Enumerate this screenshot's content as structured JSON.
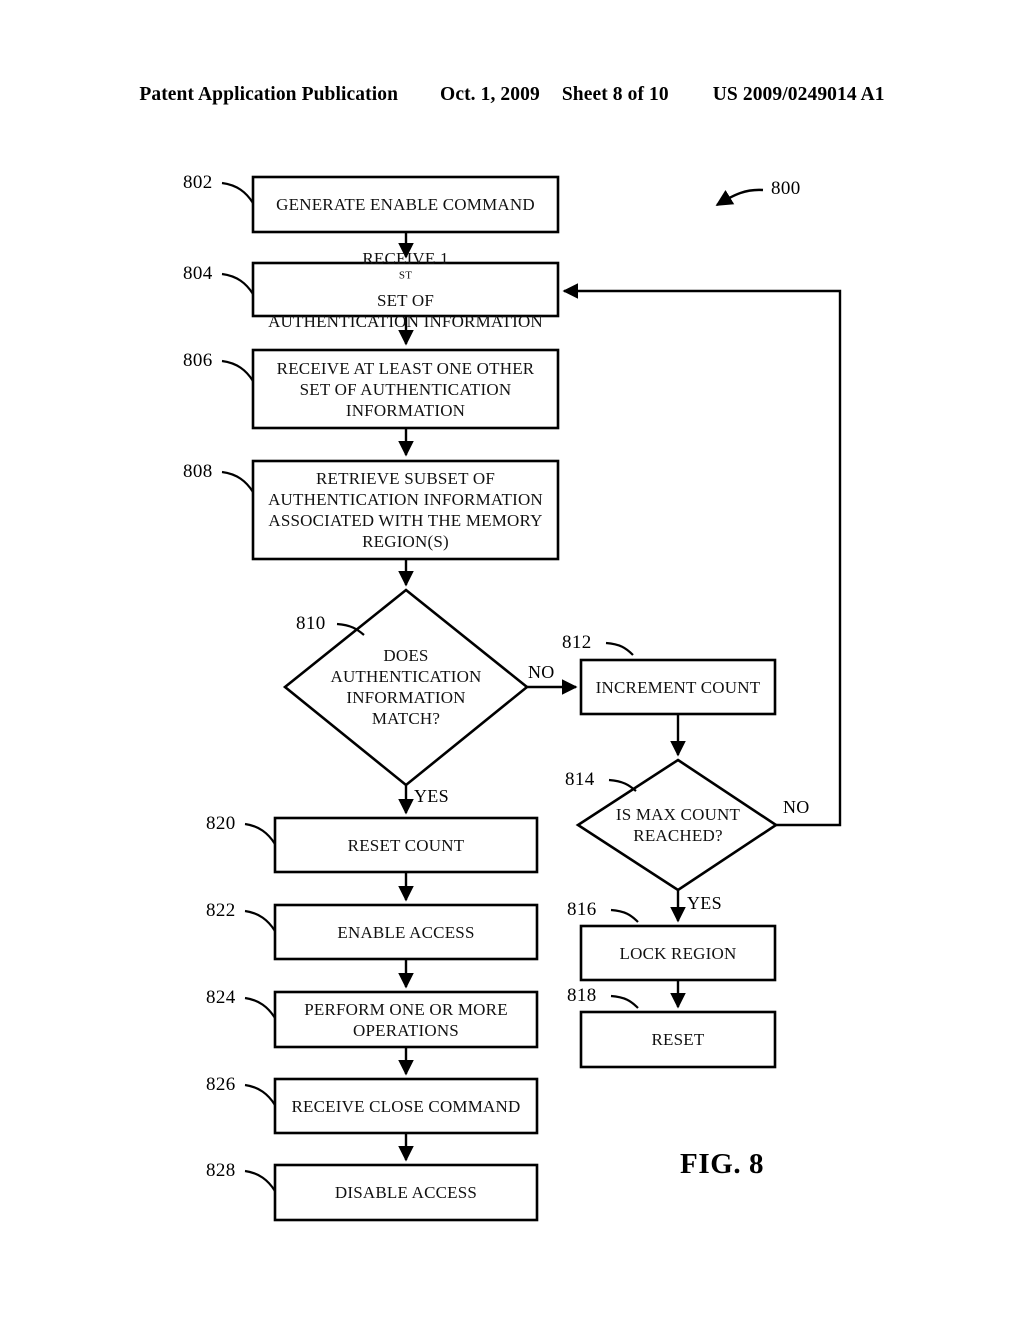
{
  "header": {
    "publication": "Patent Application Publication",
    "date": "Oct. 1, 2009",
    "sheet": "Sheet 8 of 10",
    "number": "US 2009/0249014 A1"
  },
  "figure": {
    "caption": "FIG. 8",
    "diagram_ref": "800"
  },
  "nodes": [
    {
      "ref": "802",
      "shape": "process",
      "lines": [
        "GENERATE ENABLE COMMAND"
      ]
    },
    {
      "ref": "804",
      "shape": "process",
      "lines": [
        "RECEIVE 1ST SET OF",
        "AUTHENTICATION INFORMATION"
      ],
      "superscript": "ST"
    },
    {
      "ref": "806",
      "shape": "process",
      "lines": [
        "RECEIVE AT LEAST ONE OTHER",
        "SET OF AUTHENTICATION",
        "INFORMATION"
      ]
    },
    {
      "ref": "808",
      "shape": "process",
      "lines": [
        "RETRIEVE SUBSET OF",
        "AUTHENTICATION INFORMATION",
        "ASSOCIATED WITH THE MEMORY",
        "REGION(S)"
      ]
    },
    {
      "ref": "810",
      "shape": "decision",
      "lines": [
        "DOES",
        "AUTHENTICATION",
        "INFORMATION",
        "MATCH?"
      ]
    },
    {
      "ref": "812",
      "shape": "process",
      "lines": [
        "INCREMENT COUNT"
      ]
    },
    {
      "ref": "814",
      "shape": "decision",
      "lines": [
        "IS MAX COUNT",
        "REACHED?"
      ]
    },
    {
      "ref": "816",
      "shape": "process",
      "lines": [
        "LOCK REGION"
      ]
    },
    {
      "ref": "818",
      "shape": "process",
      "lines": [
        "RESET"
      ]
    },
    {
      "ref": "820",
      "shape": "process",
      "lines": [
        "RESET COUNT"
      ]
    },
    {
      "ref": "822",
      "shape": "process",
      "lines": [
        "ENABLE ACCESS"
      ]
    },
    {
      "ref": "824",
      "shape": "process",
      "lines": [
        "PERFORM ONE OR MORE",
        "OPERATIONS"
      ]
    },
    {
      "ref": "826",
      "shape": "process",
      "lines": [
        "RECEIVE CLOSE COMMAND"
      ]
    },
    {
      "ref": "828",
      "shape": "process",
      "lines": [
        "DISABLE ACCESS"
      ]
    }
  ],
  "node_text": {
    "n802_l1": "GENERATE ENABLE COMMAND",
    "n804_l1a": "RECEIVE 1",
    "n804_sup": "ST",
    "n804_l1b": " SET OF",
    "n804_l2": "AUTHENTICATION INFORMATION",
    "n806_l1": "RECEIVE AT LEAST ONE OTHER",
    "n806_l2": "SET OF AUTHENTICATION",
    "n806_l3": "INFORMATION",
    "n808_l1": "RETRIEVE SUBSET OF",
    "n808_l2": "AUTHENTICATION INFORMATION",
    "n808_l3": "ASSOCIATED WITH THE MEMORY",
    "n808_l4": "REGION(S)",
    "n810_l1": "DOES",
    "n810_l2": "AUTHENTICATION",
    "n810_l3": "INFORMATION",
    "n810_l4": "MATCH?",
    "n812_l1": "INCREMENT COUNT",
    "n814_l1": "IS MAX COUNT",
    "n814_l2": "REACHED?",
    "n816_l1": "LOCK REGION",
    "n818_l1": "RESET",
    "n820_l1": "RESET COUNT",
    "n822_l1": "ENABLE ACCESS",
    "n824_l1": "PERFORM ONE OR MORE",
    "n824_l2": "OPERATIONS",
    "n826_l1": "RECEIVE CLOSE COMMAND",
    "n828_l1": "DISABLE ACCESS"
  },
  "refs": {
    "r802": "802",
    "r804": "804",
    "r806": "806",
    "r808": "808",
    "r810": "810",
    "r812": "812",
    "r814": "814",
    "r816": "816",
    "r818": "818",
    "r820": "820",
    "r822": "822",
    "r824": "824",
    "r826": "826",
    "r828": "828",
    "r800": "800"
  },
  "branches": {
    "b810_no": "NO",
    "b810_yes": "YES",
    "b814_no": "NO",
    "b814_yes": "YES"
  },
  "colors": {
    "ink": "#000000",
    "paper": "#ffffff"
  }
}
